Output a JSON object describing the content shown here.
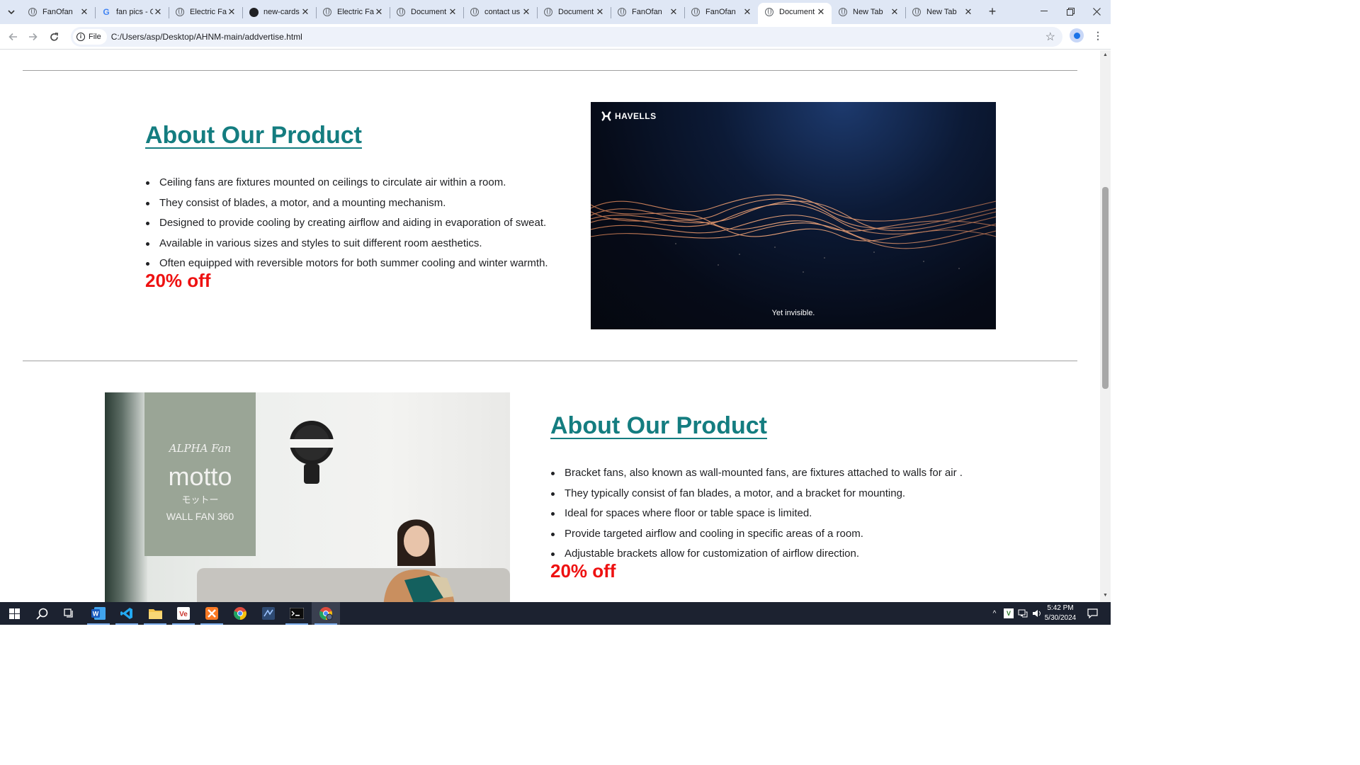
{
  "browser": {
    "tabs": [
      {
        "title": "FanOfan",
        "icon": "globe-icon"
      },
      {
        "title": "fan pics - G",
        "icon": "google-icon"
      },
      {
        "title": "Electric Fan",
        "icon": "globe-icon"
      },
      {
        "title": "new-cards",
        "icon": "github-icon"
      },
      {
        "title": "Electric Fan",
        "icon": "globe-icon"
      },
      {
        "title": "Document",
        "icon": "globe-icon"
      },
      {
        "title": "contact us",
        "icon": "globe-icon"
      },
      {
        "title": "Document",
        "icon": "globe-icon"
      },
      {
        "title": "FanOfan",
        "icon": "globe-icon"
      },
      {
        "title": "FanOfan",
        "icon": "globe-icon"
      },
      {
        "title": "Document",
        "icon": "globe-icon",
        "active": true
      },
      {
        "title": "New Tab",
        "icon": "chrome-icon"
      },
      {
        "title": "New Tab",
        "icon": "chrome-icon"
      }
    ],
    "address": {
      "scheme_label": "File",
      "url": "C:/Users/asp/Desktop/AHNM-main/addvertise.html"
    }
  },
  "page": {
    "sections": [
      {
        "title": "About Our Product",
        "bullets": [
          "Ceiling fans are fixtures mounted on ceilings to circulate air within a room.",
          "They consist of blades, a motor, and a mounting mechanism.",
          "Designed to provide cooling by creating airflow and aiding in evaporation of sweat.",
          "Available in various sizes and styles to suit different room aesthetics.",
          "Often equipped with reversible motors for both summer cooling and winter warmth."
        ],
        "discount": "20% off",
        "media": {
          "brand": "HAVELLS",
          "caption": "Yet invisible."
        }
      },
      {
        "title": "About Our Product",
        "bullets": [
          "Bracket fans, also known as wall-mounted fans, are fixtures attached to walls for air .",
          "They typically consist of fan blades, a motor, and a bracket for mounting.",
          "Ideal for spaces where floor or table space is limited.",
          "Provide targeted airflow and cooling in specific areas of a room.",
          "Adjustable brackets allow for customization of airflow direction."
        ],
        "discount": "20% off",
        "media": {
          "brand": "ALPHA Fan",
          "product": "motto",
          "product_jp": "モットー",
          "subtitle": "WALL FAN 360"
        }
      }
    ],
    "colors": {
      "heading": "#147d80",
      "discount": "#ee1111"
    }
  },
  "taskbar": {
    "clock_time": "5:42 PM",
    "clock_date": "5/30/2024",
    "apps": [
      "start-icon",
      "search-icon",
      "task-view-icon",
      "word-icon",
      "vscode-icon",
      "file-explorer-icon",
      "app-ve-icon",
      "xampp-icon",
      "chrome-icon",
      "app-blue-icon",
      "terminal-icon",
      "chrome-active-icon"
    ]
  }
}
